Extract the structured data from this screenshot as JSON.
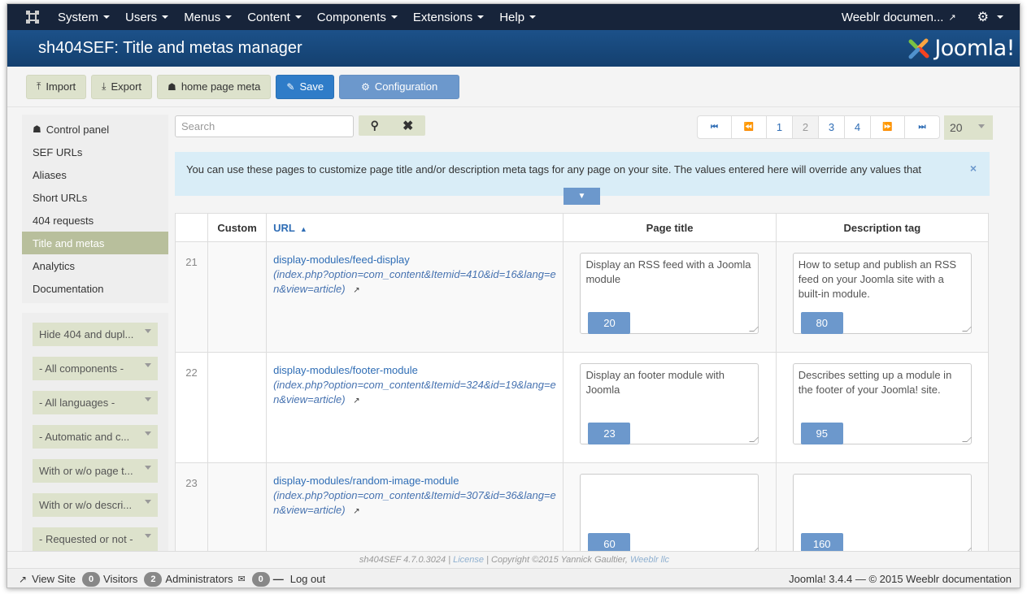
{
  "navbar": {
    "menu": [
      {
        "label": "System"
      },
      {
        "label": "Users"
      },
      {
        "label": "Menus"
      },
      {
        "label": "Content"
      },
      {
        "label": "Components"
      },
      {
        "label": "Extensions"
      },
      {
        "label": "Help"
      }
    ],
    "site_label": "Weeblr documen...",
    "settings_icon": "gear-icon"
  },
  "header": {
    "title": "sh404SEF: Title and metas manager",
    "brand": "Joomla!"
  },
  "toolbar": {
    "import": "Import",
    "export": "Export",
    "home_meta": "home page meta",
    "save": "Save",
    "configuration": "Configuration"
  },
  "sidebar": {
    "items": [
      {
        "label": "Control panel",
        "icon": "home-icon"
      },
      {
        "label": "SEF URLs"
      },
      {
        "label": "Aliases"
      },
      {
        "label": "Short URLs"
      },
      {
        "label": "404 requests"
      },
      {
        "label": "Title and metas",
        "active": true
      },
      {
        "label": "Analytics"
      },
      {
        "label": "Documentation"
      }
    ],
    "filters": [
      {
        "value": "Hide 404 and dupl..."
      },
      {
        "value": "- All components -"
      },
      {
        "value": "- All languages -"
      },
      {
        "value": "- Automatic and c..."
      },
      {
        "value": "With or w/o page t..."
      },
      {
        "value": "With or w/o descri..."
      },
      {
        "value": "- Requested or not -"
      }
    ]
  },
  "search": {
    "placeholder": "Search",
    "value": ""
  },
  "pagination": {
    "pages": [
      "1",
      "2",
      "3",
      "4"
    ],
    "current": "2",
    "limit": "20"
  },
  "alert": {
    "text": "You can use these pages to customize page title and/or description meta tags for any page on your site. The values entered here will override any values that",
    "close": "×",
    "expand": "▼"
  },
  "table": {
    "headers": {
      "num": "",
      "custom": "Custom",
      "url": "URL",
      "title": "Page title",
      "desc": "Description tag"
    },
    "rows": [
      {
        "num": "21",
        "custom": "",
        "sef": "display-modules/feed-display",
        "nonsef": "(index.php?option=com_content&Itemid=410&id=16&lang=en&view=article)",
        "title": "Display an RSS feed with a Joomla module",
        "title_count": "20",
        "desc": "How to setup and publish an RSS feed on your Joomla site with a built-in module.",
        "desc_count": "80"
      },
      {
        "num": "22",
        "custom": "",
        "sef": "display-modules/footer-module",
        "nonsef": "(index.php?option=com_content&Itemid=324&id=19&lang=en&view=article)",
        "title": "Display an footer module with Joomla",
        "title_count": "23",
        "desc": "Describes setting up a module in the footer of your Joomla! site.",
        "desc_count": "95"
      },
      {
        "num": "23",
        "custom": "",
        "sef": "display-modules/random-image-module",
        "nonsef": "(index.php?option=com_content&Itemid=307&id=36&lang=en&view=article)",
        "title": "",
        "title_count": "60",
        "desc": "",
        "desc_count": "160"
      }
    ]
  },
  "footer": {
    "version": "sh404SEF 4.7.0.3024 | ",
    "license": "License",
    "copyright": " | Copyright ©2015 Yannick Gaultier, ",
    "company": "Weeblr llc",
    "view_site": "View Site",
    "visitors_count": "0",
    "visitors": "Visitors",
    "admins_count": "2",
    "admins": "Administrators",
    "messages_count": "0",
    "logout": "Log out",
    "joomla": "Joomla! 3.4.4  —  © 2015 Weeblr documentation"
  }
}
